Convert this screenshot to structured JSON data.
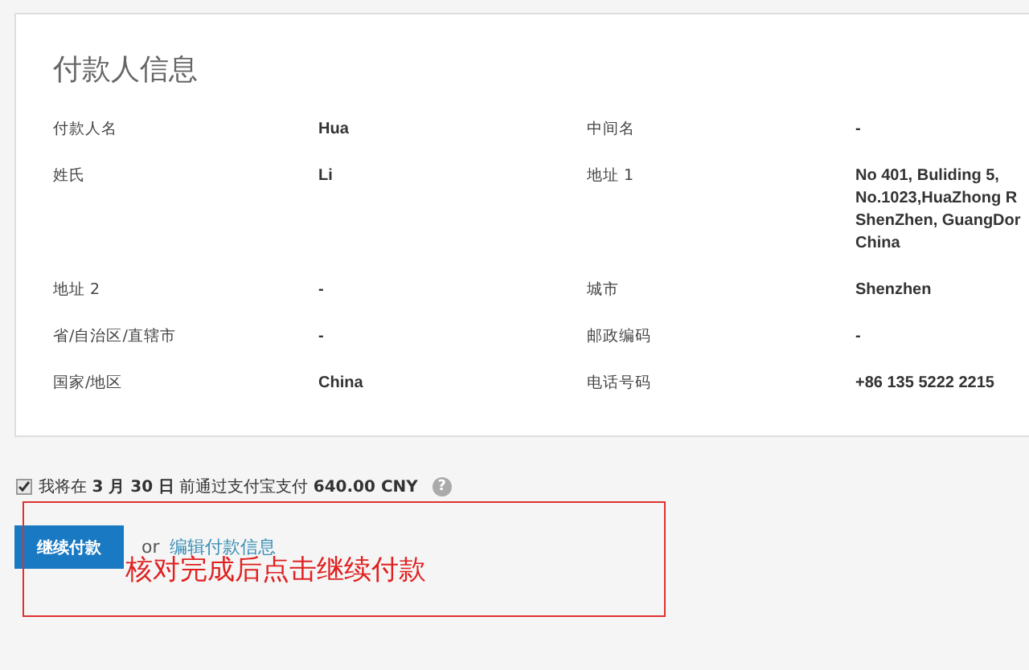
{
  "panel": {
    "title": "付款人信息",
    "rows": [
      {
        "label": "付款人名",
        "value": [
          "Hua"
        ],
        "label_2": "中间名",
        "value_2": [
          "-"
        ]
      },
      {
        "label": "姓氏",
        "value": [
          "Li"
        ],
        "label_2": "地址 1",
        "value_2": [
          "No 401, Buliding 5,",
          "No.1023,HuaZhong R",
          "ShenZhen, GuangDor",
          "China"
        ]
      },
      {
        "label": "地址 2",
        "value": [
          "-"
        ],
        "label_2": "城市",
        "value_2": [
          "Shenzhen"
        ]
      },
      {
        "label": "省/自治区/直辖市",
        "value": [
          "-"
        ],
        "label_2": "邮政编码",
        "value_2": [
          "-"
        ]
      },
      {
        "label": "国家/地区",
        "value": [
          "China"
        ],
        "label_2": "电话号码",
        "value_2": [
          "+86 135 5222 2215"
        ]
      }
    ]
  },
  "agreement": {
    "checked": true,
    "text": "我将在 **3 月 30 日** 前通过支付宝支付 **640.00 CNY**",
    "help": "?"
  },
  "actions": {
    "button": "继续付款",
    "or": "or",
    "link": "编辑付款信息"
  },
  "annotation": {
    "text": "核对完成后点击继续付款"
  }
}
